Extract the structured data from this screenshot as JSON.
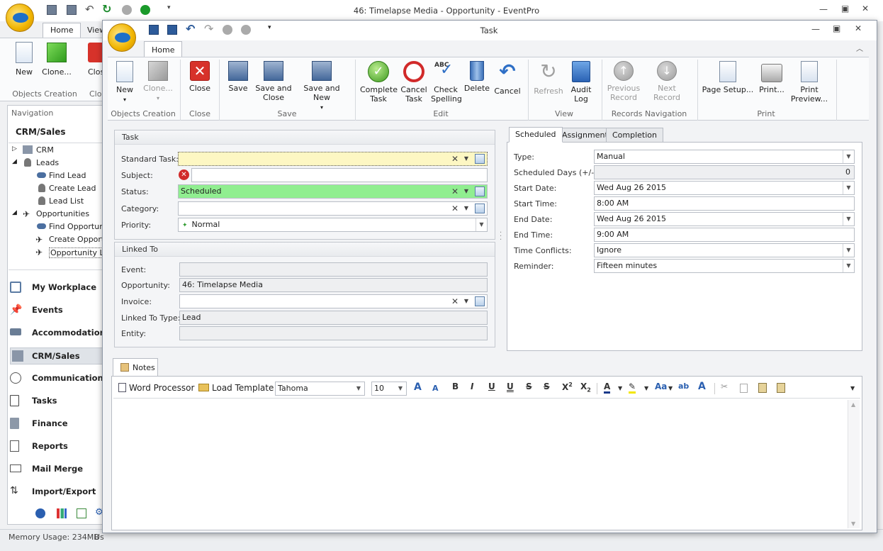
{
  "outer": {
    "title": "46: Timelapse Media - Opportunity - EventPro",
    "tabs": [
      "Home",
      "View"
    ],
    "ribbon": {
      "new": "New",
      "clone": "Clone...",
      "close": "Clos",
      "group": "Objects Creation",
      "group2": "Clo"
    },
    "nav": {
      "header": "Navigation",
      "section": "CRM/Sales",
      "tree": [
        {
          "label": "CRM"
        },
        {
          "label": "Leads"
        },
        {
          "label": "Find Lead"
        },
        {
          "label": "Create Lead"
        },
        {
          "label": "Lead List"
        },
        {
          "label": "Opportunities"
        },
        {
          "label": "Find Opportunit"
        },
        {
          "label": "Create Opportu"
        },
        {
          "label": "Opportunity Lis"
        }
      ],
      "items": [
        "My Workplace",
        "Events",
        "Accommodations",
        "CRM/Sales",
        "Communications",
        "Tasks",
        "Finance",
        "Reports",
        "Mail Merge",
        "Import/Export"
      ]
    },
    "status": {
      "memory": "Memory Usage: 234MB",
      "user": "Us"
    }
  },
  "task": {
    "title": "Task",
    "tab": "Home",
    "ribbon": {
      "objects": {
        "new": "New",
        "clone": "Clone...",
        "group": "Objects Creation"
      },
      "close": {
        "close": "Close",
        "group": "Close"
      },
      "save": {
        "save": "Save",
        "save_close": [
          "Save and",
          "Close"
        ],
        "save_new": "Save and New",
        "group": "Save"
      },
      "edit": {
        "complete": [
          "Complete",
          "Task"
        ],
        "cancel_task": [
          "Cancel",
          "Task"
        ],
        "check": [
          "Check",
          "Spelling"
        ],
        "delete": "Delete",
        "cancel": "Cancel",
        "group": "Edit",
        "abc": "ABC"
      },
      "view": {
        "refresh": "Refresh",
        "audit": [
          "Audit",
          "Log"
        ],
        "group": "View"
      },
      "records": {
        "prev": [
          "Previous",
          "Record"
        ],
        "next": "Next Record",
        "group": "Records Navigation"
      },
      "print": {
        "page_setup": "Page Setup...",
        "print": "Print...",
        "preview": [
          "Print",
          "Preview..."
        ],
        "group": "Print"
      }
    },
    "task_panel": {
      "header": "Task",
      "standard_task_label": "Standard Task:",
      "standard_task": "",
      "subject_label": "Subject:",
      "subject": "",
      "status_label": "Status:",
      "status": "Scheduled",
      "category_label": "Category:",
      "category": "",
      "priority_label": "Priority:",
      "priority": "Normal"
    },
    "linked_panel": {
      "header": "Linked To",
      "event_label": "Event:",
      "event": "",
      "opportunity_label": "Opportunity:",
      "opportunity": "46: Timelapse Media",
      "invoice_label": "Invoice:",
      "invoice": "",
      "linked_type_label": "Linked To Type:",
      "linked_type": "Lead",
      "entity_label": "Entity:",
      "entity": ""
    },
    "right_tabs": [
      "Scheduled",
      "Assignment",
      "Completion"
    ],
    "schedule": {
      "type_label": "Type:",
      "type": "Manual",
      "days_label": "Scheduled Days (+/-):",
      "days": "0",
      "start_date_label": "Start Date:",
      "start_date": "Wed Aug 26 2015",
      "start_time_label": "Start Time:",
      "start_time": "8:00 AM",
      "end_date_label": "End Date:",
      "end_date": "Wed Aug 26 2015",
      "end_time_label": "End Time:",
      "end_time": "9:00 AM",
      "conflicts_label": "Time Conflicts:",
      "conflicts": "Ignore",
      "reminder_label": "Reminder:",
      "reminder": "Fifteen minutes"
    },
    "notes": {
      "tab": "Notes",
      "word_processor": "Word Processor",
      "load_template": "Load Template",
      "font": "Tahoma",
      "size": "10"
    }
  },
  "colors": {
    "status_green": "#90ee90",
    "required_yellow": "#fdf7c3",
    "accent": "#2b6cb0"
  }
}
